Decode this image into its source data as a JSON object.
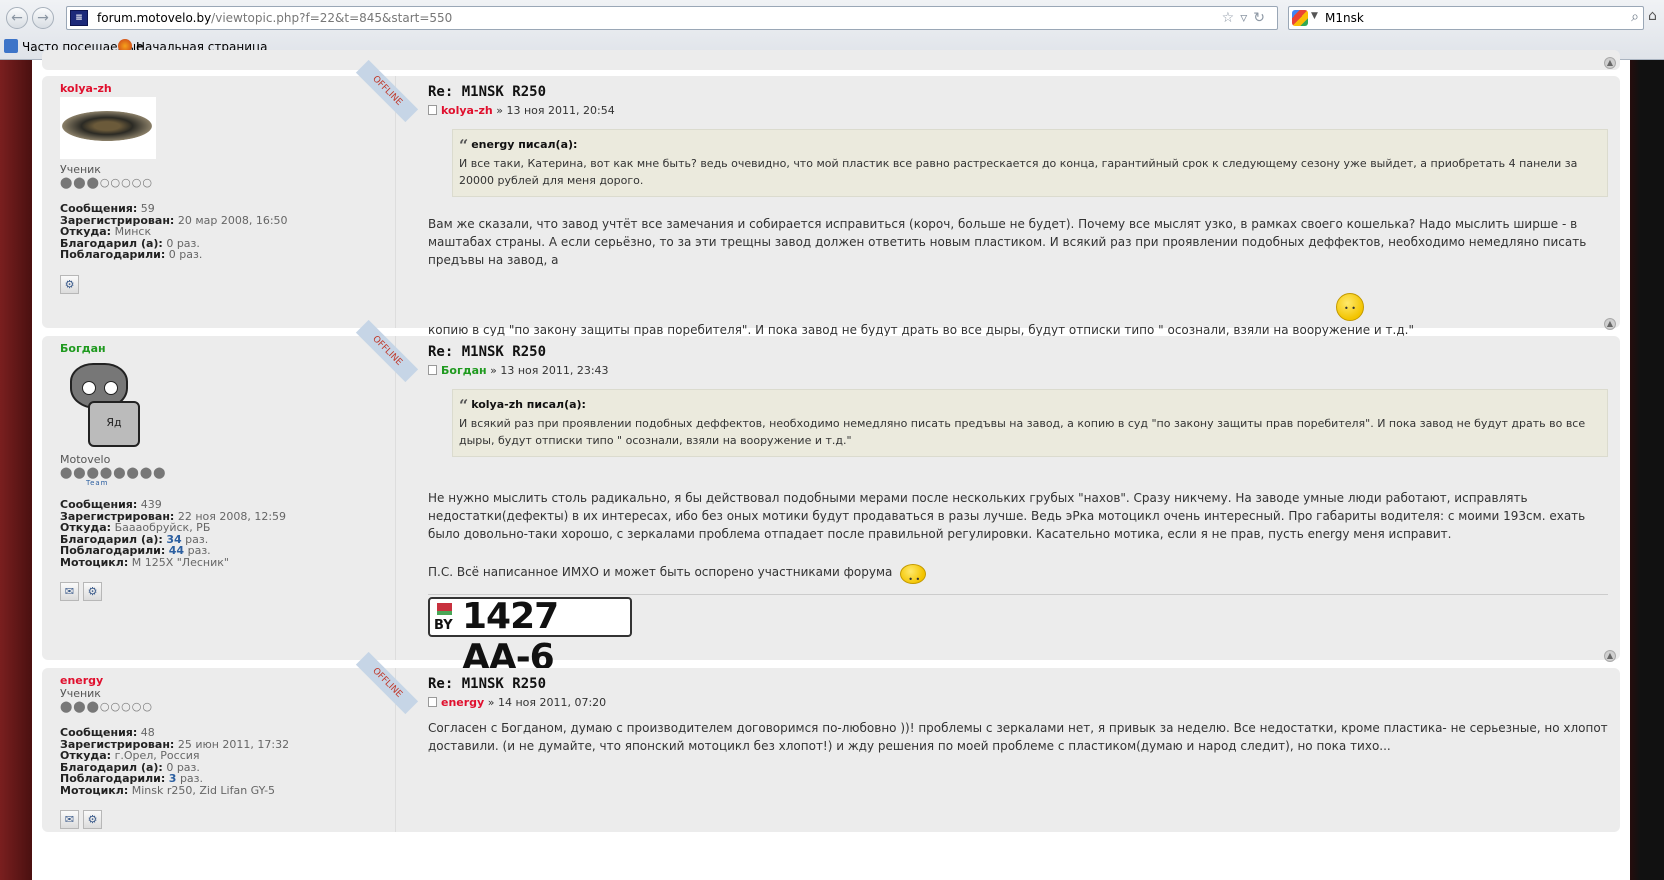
{
  "browser": {
    "url_host": "forum.motovelo.by",
    "url_path": "/viewtopic.php?f=22&t=845&start=550",
    "search_query": "M1nsk",
    "bookmarks": [
      "Часто посещаемые",
      "Начальная страница"
    ]
  },
  "labels": {
    "posts": "Сообщения:",
    "registered": "Зарегистрирован:",
    "from": "Откуда:",
    "thanked": "Благодарил (а):",
    "thanked_by": "Поблагодарили:",
    "bike": "Мотоцикл:",
    "times": "раз.",
    "offline": "OFFLINE"
  },
  "posts": [
    {
      "author": "kolya-zh",
      "author_color": "#e0102e",
      "rank": "Ученик",
      "stats": {
        "posts": "59",
        "registered": "20 мар 2008, 16:50",
        "from": "Минск",
        "thanked": "0",
        "thanked_by": "0"
      },
      "title": "Re: M1NSK R250",
      "date": "» 13 ноя 2011, 20:54",
      "quote_cite": "energy писал(а):",
      "quote_text": "И все таки, Катерина, вот как мне быть? ведь очевидно, что мой пластик все равно растрескается до конца, гарантийный срок к следующему сезону уже выйдет, а приобретать 4 панели за 20000 рублей для меня дорого.",
      "text_1": "Вам же сказали, что завод учтёт все замечания и собирается исправиться (короч, больше не будет). Почему все мыслят узко, в рамках своего кошелька? Надо мыслить ширше - в маштабах страны. А если серьёзно, то за эти трещны завод должен ответить новым пластиком. И всякий раз при проявлении подобных деффектов, необходимо немедляно писать предъвы на завод, а",
      "text_2": "копию в суд \"по закону защиты прав поребителя\". И пока завод не будут драть во все дыры, будут отписки типо \" осознали, взяли на вооружение и т.д.\""
    },
    {
      "author": "Богдан",
      "author_color": "#1f9a1f",
      "rank": "Motovelo",
      "stats": {
        "posts": "439",
        "registered": "22 ноя 2008, 12:59",
        "from": "Баааобруйск, РБ",
        "thanked": "34",
        "thanked_by": "44",
        "bike": "М 125Х \"Лесник\""
      },
      "title": "Re: M1NSK R250",
      "date": "» 13 ноя 2011, 23:43",
      "quote_cite": "kolya-zh писал(а):",
      "quote_text": "И всякий раз при проявлении подобных деффектов, необходимо немедляно писать предъвы на завод, а копию в суд \"по закону защиты прав поребителя\". И пока завод не будут драть во все дыры, будут отписки типо \" осознали, взяли на вооружение и т.д.\"",
      "text_1": "Не нужно мыслить столь радикально, я бы действовал подобными мерами после нескольких грубых \"нахов\". Сразу никчему. На заводе умные люди работают, исправлять недостатки(дефекты) в их интересах, ибо без оных мотики будут продаваться в разы лучше. Ведь эРка мотоцикл очень интересный. Про габариты водителя: с моими 193см. ехать было довольно-таки хорошо, с зеркалами проблема отпадает после правильной регулировки. Касательно мотика, если я не прав, пусть energy меня исправит.",
      "text_2": "П.С. Всё написанное ИМХО и может быть оспорено участниками форума",
      "plate_country": "BY",
      "plate_number": "1427 AA-6",
      "avatar_label": "Яд",
      "rank_sub": "Team"
    },
    {
      "author": "energy",
      "author_color": "#e0102e",
      "rank": "Ученик",
      "stats": {
        "posts": "48",
        "registered": "25 июн 2011, 17:32",
        "from": "г.Орел, Россия",
        "thanked": "0",
        "thanked_by": "3",
        "bike": "Minsk r250, Zid Lifan GY-5"
      },
      "title": "Re: M1NSK R250",
      "date": "» 14 ноя 2011, 07:20",
      "text_1": "Согласен с Богданом, думаю с производителем договоримся по-любовно ))! проблемы с зеркалами нет, я привык за неделю. Все недостатки, кроме пластика- не серьезные, но хлопот доставили. (и не думайте, что японский мотоцикл без хлопот!) и жду решения по моей проблеме с пластиком(думаю и народ следит), но пока тихо..."
    }
  ]
}
